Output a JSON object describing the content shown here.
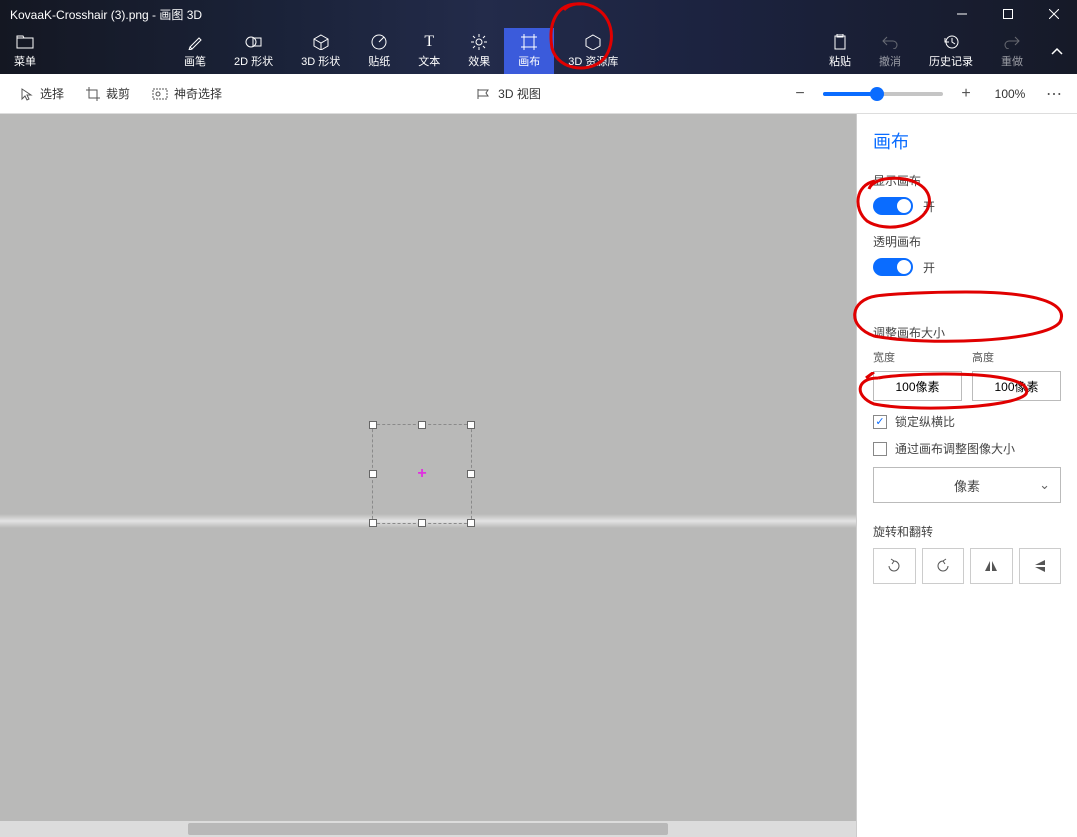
{
  "title": "KovaaK-Crosshair (3).png - 画图 3D",
  "ribbon": {
    "menu": "菜单",
    "brush": "画笔",
    "shapes2d": "2D 形状",
    "shapes3d": "3D 形状",
    "stickers": "贴纸",
    "text": "文本",
    "effects": "效果",
    "canvas": "画布",
    "library3d": "3D 资源库",
    "paste": "粘贴",
    "undo": "撤消",
    "history": "历史记录",
    "redo": "重做"
  },
  "toolbar": {
    "select": "选择",
    "crop": "裁剪",
    "magic": "神奇选择",
    "view3d": "3D 视图",
    "zoom": "100%"
  },
  "panel": {
    "title": "画布",
    "show_canvas_label": "显示画布",
    "show_canvas_state": "开",
    "transparent_label": "透明画布",
    "transparent_state": "开",
    "resize_title": "调整画布大小",
    "width_label": "宽度",
    "height_label": "高度",
    "width_value": "100像素",
    "height_value": "100像素",
    "lock_aspect": "锁定纵横比",
    "resize_with_canvas": "通过画布调整图像大小",
    "unit": "像素",
    "rotate_title": "旋转和翻转"
  }
}
